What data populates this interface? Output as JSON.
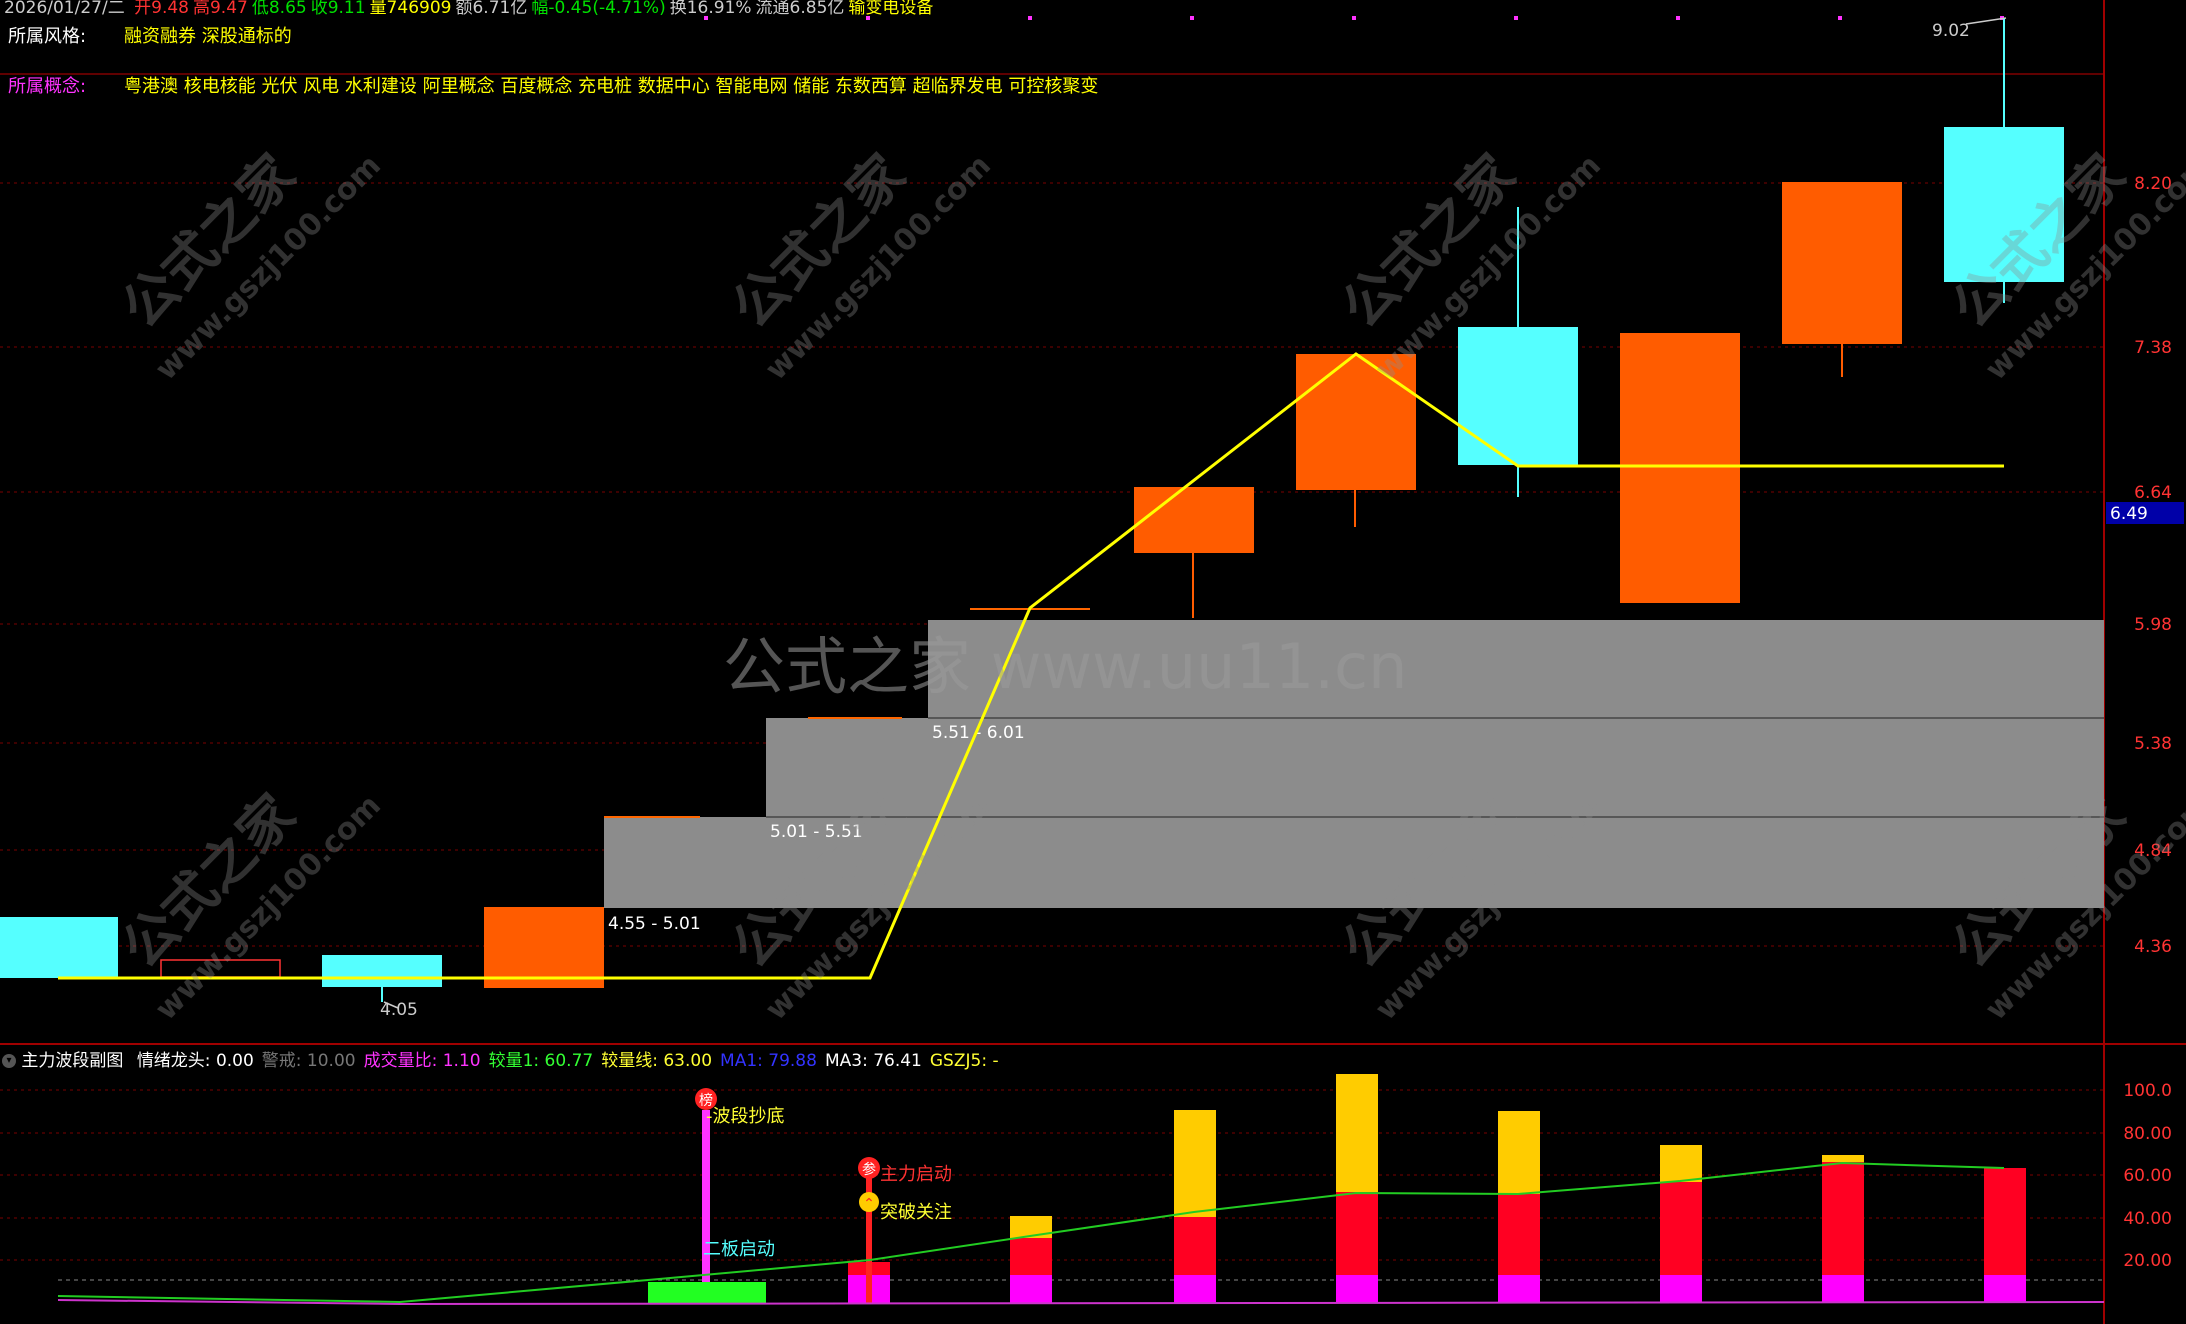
{
  "header": {
    "date": "2026/01/27/二",
    "stats": [
      {
        "label": "开",
        "value": "9.48",
        "color": "#ff3333"
      },
      {
        "label": "高",
        "value": "9.47",
        "color": "#ff3333"
      },
      {
        "label": "低",
        "value": "8.65",
        "color": "#00e000"
      },
      {
        "label": "收",
        "value": "9.11",
        "color": "#00e000"
      },
      {
        "label": "量",
        "value": "746909",
        "color": "#ffff00"
      },
      {
        "label": "额",
        "value": "6.71亿",
        "color": "#cccccc"
      },
      {
        "label": "幅",
        "value": "-0.45(-4.71%)",
        "color": "#00e000"
      },
      {
        "label": "换",
        "value": "16.91%",
        "color": "#cccccc"
      },
      {
        "label": "流通",
        "value": "6.85亿",
        "color": "#cccccc"
      },
      {
        "label": "",
        "value": "输变电设备",
        "color": "#ffff00"
      }
    ],
    "style_label": "所属风格:",
    "style_value": "融资融券 深股通标的",
    "concept_label": "所属概念:",
    "concept_value": "粤港澳 核电核能 光伏 风电 水利建设 阿里概念 百度概念 充电桩 数据中心 智能电网 储能 东数西算 超临界发电 可控核聚变"
  },
  "price_axis": {
    "ticks": [
      "8.20",
      "7.38",
      "6.64",
      "5.98",
      "5.38",
      "4.84",
      "4.36"
    ],
    "current_price": "6.49",
    "high_label": "9.02",
    "low_label": "4.05"
  },
  "zones": [
    {
      "label": "4.55 - 5.01"
    },
    {
      "label": "5.01 - 5.51"
    },
    {
      "label": "5.51 - 6.01"
    }
  ],
  "watermarks": {
    "center": "公式之家 www.uu11.cn",
    "diagonal_cn": "公式之家",
    "diagonal_url": "www.gszj100.com"
  },
  "indicator": {
    "title": "主力波段副图",
    "items": [
      {
        "label": "情绪龙头",
        "value": "0.00",
        "color": "#ffffff"
      },
      {
        "label": "警戒",
        "value": "10.00",
        "color": "#777777"
      },
      {
        "label": "成交量比",
        "value": "1.10",
        "color": "#ff33ff"
      },
      {
        "label": "较量1",
        "value": "60.77",
        "color": "#33ff33"
      },
      {
        "label": "较量线",
        "value": "63.00",
        "color": "#ffff33"
      },
      {
        "label": "MA1",
        "value": "79.88",
        "color": "#3333ff"
      },
      {
        "label": "MA3",
        "value": "76.41",
        "color": "#ffffff"
      },
      {
        "label": "GSZJ5",
        "value": "-",
        "color": "#ffff33"
      }
    ],
    "ticks": [
      "100.0",
      "80.00",
      "60.00",
      "40.00",
      "20.00"
    ],
    "signals": {
      "bang_icon": "榜",
      "wave_bottom": "波段抄底",
      "second_board": "二板启动",
      "zhu_icon": "参",
      "main_start": "主力启动",
      "breakout": "突破关注"
    }
  },
  "colors": {
    "up": "#ff6600",
    "down": "#55ffff",
    "zone": "#8c8c8c",
    "yellow_line": "#ffff00",
    "grid": "#7a0000"
  }
}
